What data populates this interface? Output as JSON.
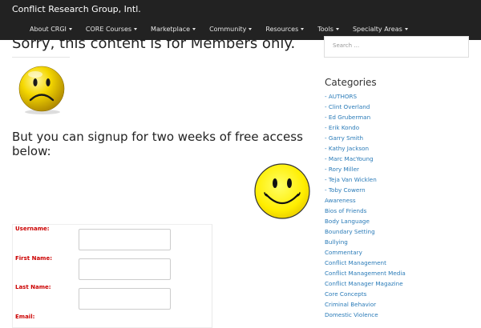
{
  "site": {
    "brand": "Conflict Research Group, Intl.",
    "nav": [
      "About CRGI",
      "CORE Courses",
      "Marketplace",
      "Community",
      "Resources",
      "Tools",
      "Specialty Areas"
    ]
  },
  "main": {
    "headline": "Sorry, this content is for Members only.",
    "signup_text": "But you can signup for two weeks of free access below:",
    "form": {
      "username_label": "Username:",
      "first_name_label": "First Name:",
      "last_name_label": "Last Name:",
      "email_label": "Email:"
    }
  },
  "sidebar": {
    "search_placeholder": "Search …",
    "categories_title": "Categories",
    "categories": [
      "- AUTHORS",
      "- Clint Overland",
      "- Ed Gruberman",
      "- Erik Kondo",
      "- Garry Smith",
      "- Kathy Jackson",
      "- Marc MacYoung",
      "- Rory Miller",
      "- Teja Van Wicklen",
      "- Toby Cowern",
      "Awareness",
      "Bios of Friends",
      "Body Language",
      "Boundary Setting",
      "Bullying",
      "Commentary",
      "Conflict Management",
      "Conflict Management Media",
      "Conflict Manager Magazine",
      "Core Concepts",
      "Criminal Behavior",
      "Domestic Violence"
    ]
  },
  "colors": {
    "topbar": "#222222",
    "link": "#2a7bb8",
    "required_label": "#cc0000"
  }
}
